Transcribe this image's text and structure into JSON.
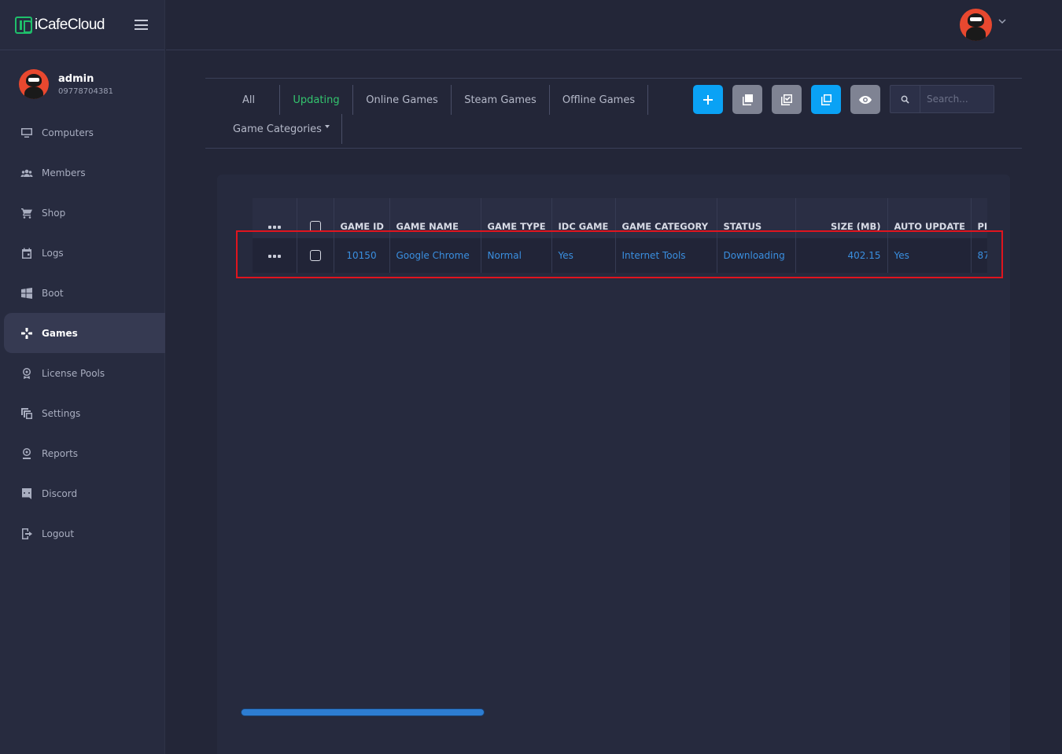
{
  "app": {
    "logo_text": "iCafeCloud",
    "brand_color": "#1fbf6b",
    "accent_color": "#0aa2f5"
  },
  "user": {
    "name": "admin",
    "phone": "09778704381"
  },
  "sidebar": {
    "items": [
      {
        "label": "Computers",
        "icon": "monitor-icon"
      },
      {
        "label": "Members",
        "icon": "users-icon"
      },
      {
        "label": "Shop",
        "icon": "cart-icon"
      },
      {
        "label": "Logs",
        "icon": "calendar-icon"
      },
      {
        "label": "Boot",
        "icon": "windows-icon"
      },
      {
        "label": "Games",
        "icon": "gamepad-icon",
        "active": true
      },
      {
        "label": "License Pools",
        "icon": "badge-icon"
      },
      {
        "label": "Settings",
        "icon": "settings-icon"
      },
      {
        "label": "Reports",
        "icon": "report-icon"
      },
      {
        "label": "Discord",
        "icon": "discord-icon"
      },
      {
        "label": "Logout",
        "icon": "logout-icon"
      }
    ]
  },
  "tabs": {
    "all": "All",
    "updating": "Updating",
    "online": "Online Games",
    "steam": "Steam Games",
    "offline": "Offline Games",
    "categories": "Game Categories",
    "active": "Updating"
  },
  "toolbar": {
    "buttons": [
      "plus-icon",
      "copy-icon",
      "check-square-icon",
      "duplicate-icon",
      "eye-icon"
    ],
    "search_placeholder": "Search..."
  },
  "table": {
    "headers": {
      "game_id": "GAME ID",
      "game_name": "GAME NAME",
      "game_type": "GAME TYPE",
      "idc_game": "IDC GAME",
      "game_category": "GAME CATEGORY",
      "status": "STATUS",
      "size": "SIZE (MB)",
      "auto_update": "AUTO UPDATE",
      "partial": "PI"
    },
    "rows": [
      {
        "game_id": "10150",
        "game_name": "Google Chrome",
        "game_type": "Normal",
        "idc_game": "Yes",
        "game_category": "Internet Tools",
        "status": "Downloading",
        "size": "402.15",
        "auto_update": "Yes",
        "partial": "87"
      }
    ]
  }
}
